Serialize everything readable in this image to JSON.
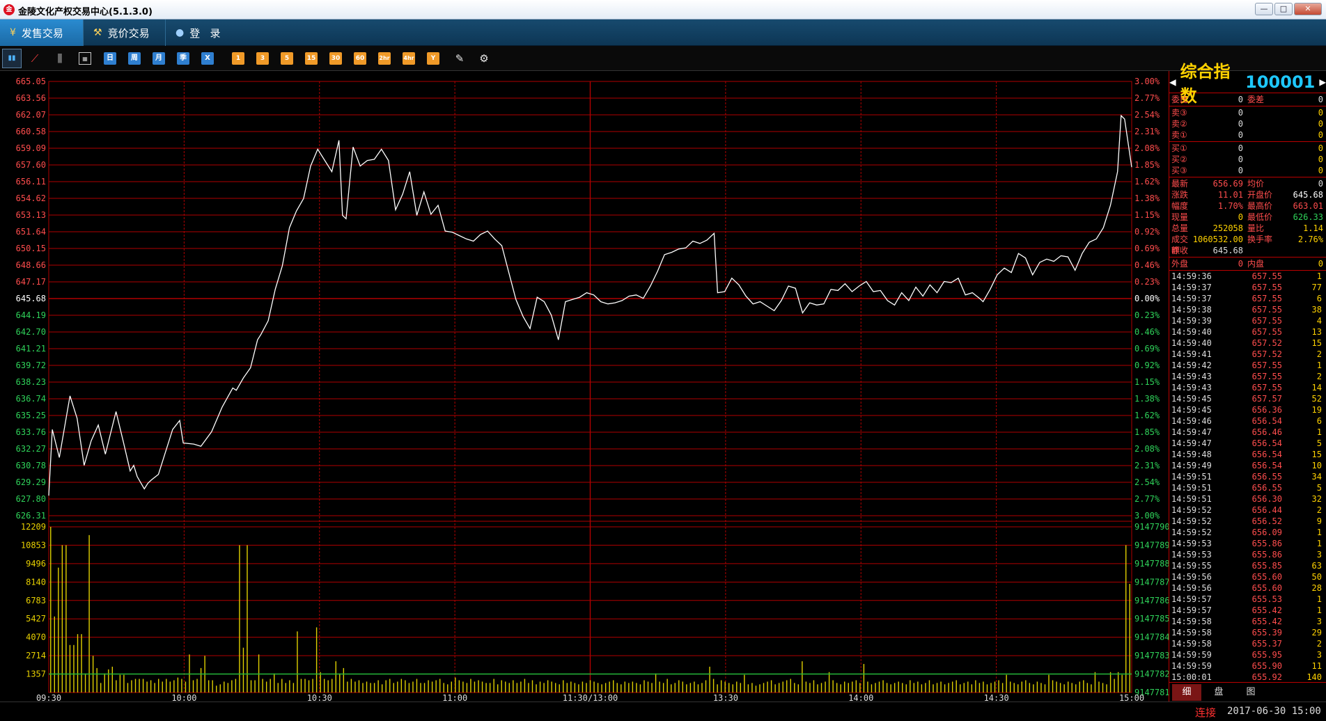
{
  "window": {
    "title": "金陵文化产权交易中心(5.1.3.0)",
    "logo": "logo-icon"
  },
  "tabs": [
    {
      "label": "发售交易",
      "icon": "yen-icon",
      "active": true
    },
    {
      "label": "竞价交易",
      "icon": "gavel-icon",
      "active": false
    },
    {
      "label": "登   录",
      "icon": "user-icon",
      "active": false
    }
  ],
  "toolbar": {
    "text_buttons": [
      "日",
      "周",
      "月",
      "季",
      "X",
      "1",
      "3",
      "5",
      "15",
      "30",
      "60",
      "2hr",
      "4hr",
      "Y"
    ]
  },
  "chart_data": {
    "type": "line",
    "price_axis": {
      "reference": 645.68,
      "left_ticks": [
        "665.05",
        "663.56",
        "662.07",
        "660.58",
        "659.09",
        "657.60",
        "656.11",
        "654.62",
        "653.13",
        "651.64",
        "650.15",
        "648.66",
        "647.17",
        "645.68",
        "644.19",
        "642.70",
        "641.21",
        "639.72",
        "638.23",
        "636.74",
        "635.25",
        "633.76",
        "632.27",
        "630.78",
        "629.29",
        "627.80",
        "626.31"
      ],
      "right_ticks": [
        "3.00%",
        "2.77%",
        "2.54%",
        "2.31%",
        "2.08%",
        "1.85%",
        "1.62%",
        "1.38%",
        "1.15%",
        "0.92%",
        "0.69%",
        "0.46%",
        "0.23%",
        "0.00%",
        "0.23%",
        "0.46%",
        "0.69%",
        "0.92%",
        "1.15%",
        "1.38%",
        "1.62%",
        "1.85%",
        "2.08%",
        "2.31%",
        "2.54%",
        "2.77%",
        "3.00%"
      ],
      "ylim": [
        626.31,
        665.05
      ]
    },
    "volume_axis": {
      "left_ticks": [
        "12209",
        "10853",
        "9496",
        "8140",
        "6783",
        "5427",
        "4070",
        "2714",
        "1357"
      ],
      "right_ticks": [
        "9147790",
        "9147789",
        "9147788",
        "9147787",
        "9147786",
        "9147785",
        "9147784",
        "9147783",
        "9147782",
        "9147781"
      ],
      "ylim": [
        0,
        12209
      ],
      "average": 1357
    },
    "time_labels": [
      "09:30",
      "10:00",
      "10:30",
      "11:00",
      "11:30/13:00",
      "13:30",
      "14:00",
      "14:30",
      "15:00"
    ],
    "price_series": [
      [
        0,
        628.1
      ],
      [
        1,
        634
      ],
      [
        3,
        631.5
      ],
      [
        6,
        637
      ],
      [
        8,
        635
      ],
      [
        10,
        630.8
      ],
      [
        12,
        633
      ],
      [
        14,
        634.4
      ],
      [
        16,
        631.8
      ],
      [
        19,
        635.6
      ],
      [
        21,
        633
      ],
      [
        23,
        630.3
      ],
      [
        24,
        630.8
      ],
      [
        25,
        629.8
      ],
      [
        27,
        628.7
      ],
      [
        28,
        629.2
      ],
      [
        29,
        629.5
      ],
      [
        31,
        630
      ],
      [
        33,
        632
      ],
      [
        35,
        634
      ],
      [
        37,
        634.8
      ],
      [
        38,
        632.8
      ],
      [
        41,
        632.7
      ],
      [
        43,
        632.5
      ],
      [
        46,
        633.8
      ],
      [
        49,
        636
      ],
      [
        52,
        637.7
      ],
      [
        53,
        637.5
      ],
      [
        55,
        638.6
      ],
      [
        57,
        639.5
      ],
      [
        59,
        642
      ],
      [
        60,
        642.5
      ],
      [
        62,
        643.7
      ],
      [
        64,
        646.5
      ],
      [
        66,
        648.6
      ],
      [
        68,
        652
      ],
      [
        70,
        653.5
      ],
      [
        72,
        654.6
      ],
      [
        74,
        657.5
      ],
      [
        76,
        659
      ],
      [
        78,
        658
      ],
      [
        80,
        657
      ],
      [
        82,
        659.8
      ],
      [
        83,
        653.1
      ],
      [
        84,
        652.8
      ],
      [
        86,
        659.2
      ],
      [
        88,
        657.5
      ],
      [
        90,
        658
      ],
      [
        92,
        658.1
      ],
      [
        94,
        659
      ],
      [
        96,
        658
      ],
      [
        98,
        653.6
      ],
      [
        100,
        655
      ],
      [
        102,
        657
      ],
      [
        104,
        653.1
      ],
      [
        106,
        655.2
      ],
      [
        108,
        653.2
      ],
      [
        110,
        654
      ],
      [
        112,
        651.7
      ],
      [
        114,
        651.6
      ],
      [
        116,
        651.3
      ],
      [
        118,
        651
      ],
      [
        120,
        650.8
      ],
      [
        122,
        651.4
      ],
      [
        124,
        651.7
      ],
      [
        126,
        651
      ],
      [
        128,
        650.4
      ],
      [
        130,
        648
      ],
      [
        132,
        645.6
      ],
      [
        134,
        644.1
      ],
      [
        136,
        643
      ],
      [
        138,
        645.8
      ],
      [
        140,
        645.4
      ],
      [
        142,
        644.2
      ],
      [
        144,
        642
      ],
      [
        146,
        645.4
      ],
      [
        148,
        645.6
      ],
      [
        150,
        645.8
      ],
      [
        152,
        646.2
      ],
      [
        154,
        646
      ],
      [
        156,
        645.4
      ],
      [
        158,
        645.2
      ],
      [
        160,
        645.3
      ],
      [
        162,
        645.5
      ],
      [
        164,
        645.9
      ],
      [
        166,
        646
      ],
      [
        168,
        645.7
      ],
      [
        170,
        646.8
      ],
      [
        172,
        648.1
      ],
      [
        174,
        649.6
      ],
      [
        176,
        649.8
      ],
      [
        178,
        650.1
      ],
      [
        180,
        650.2
      ],
      [
        182,
        650.8
      ],
      [
        184,
        650.6
      ],
      [
        186,
        650.9
      ],
      [
        188,
        651.5
      ],
      [
        189,
        646.2
      ],
      [
        191,
        646.3
      ],
      [
        193,
        647.5
      ],
      [
        195,
        646.9
      ],
      [
        197,
        645.9
      ],
      [
        199,
        645.2
      ],
      [
        201,
        645.4
      ],
      [
        203,
        645
      ],
      [
        205,
        644.6
      ],
      [
        207,
        645.5
      ],
      [
        209,
        646.8
      ],
      [
        211,
        646.6
      ],
      [
        213,
        644.4
      ],
      [
        215,
        645.3
      ],
      [
        217,
        645.1
      ],
      [
        219,
        645.2
      ],
      [
        221,
        646.5
      ],
      [
        223,
        646.4
      ],
      [
        225,
        647
      ],
      [
        227,
        646.3
      ],
      [
        229,
        646.8
      ],
      [
        231,
        647.2
      ],
      [
        233,
        646.3
      ],
      [
        235,
        646.4
      ],
      [
        237,
        645.5
      ],
      [
        239,
        645.1
      ],
      [
        241,
        646.2
      ],
      [
        243,
        645.5
      ],
      [
        245,
        646.7
      ],
      [
        247,
        645.9
      ],
      [
        249,
        646.9
      ],
      [
        251,
        646.2
      ],
      [
        253,
        647.2
      ],
      [
        255,
        647.1
      ],
      [
        257,
        647.5
      ],
      [
        259,
        646
      ],
      [
        261,
        646.2
      ],
      [
        263,
        645.7
      ],
      [
        264,
        645.4
      ],
      [
        266,
        646.5
      ],
      [
        268,
        647.8
      ],
      [
        270,
        648.4
      ],
      [
        272,
        648
      ],
      [
        274,
        649.7
      ],
      [
        276,
        649.3
      ],
      [
        278,
        647.8
      ],
      [
        280,
        648.9
      ],
      [
        282,
        649.2
      ],
      [
        284,
        649
      ],
      [
        286,
        649.5
      ],
      [
        288,
        649.4
      ],
      [
        290,
        648.2
      ],
      [
        292,
        649.7
      ],
      [
        294,
        650.7
      ],
      [
        296,
        651
      ],
      [
        298,
        652
      ],
      [
        299,
        653
      ],
      [
        300,
        654
      ],
      [
        302,
        657
      ],
      [
        303,
        662
      ],
      [
        304,
        661.7
      ],
      [
        306,
        657.4
      ]
    ],
    "volume_series": [
      12209,
      5600,
      9200,
      10853,
      10853,
      3500,
      3500,
      4300,
      4300,
      1400,
      11600,
      2700,
      1800,
      700,
      1400,
      1700,
      1900,
      900,
      1300,
      1300,
      700,
      900,
      1000,
      1000,
      1000,
      800,
      900,
      700,
      1000,
      800,
      1000,
      800,
      900,
      1100,
      1000,
      800,
      2800,
      900,
      1000,
      1800,
      2700,
      900,
      900,
      500,
      600,
      800,
      700,
      900,
      1000,
      10853,
      3300,
      10853,
      900,
      900,
      2800,
      1000,
      800,
      1000,
      1400,
      700,
      1000,
      700,
      900,
      700,
      4500,
      1000,
      1000,
      900,
      1000,
      4800,
      1500,
      1000,
      900,
      1000,
      2300,
      1400,
      1800,
      800,
      1000,
      800,
      900,
      700,
      800,
      700,
      700,
      900,
      600,
      900,
      1000,
      700,
      800,
      1000,
      900,
      700,
      800,
      1000,
      700,
      700,
      900,
      800,
      900,
      1000,
      700,
      600,
      800,
      1100,
      900,
      800,
      700,
      1000,
      800,
      900,
      800,
      700,
      700,
      1000,
      600,
      900,
      800,
      700,
      900,
      700,
      800,
      1000,
      700,
      900,
      600,
      800,
      700,
      900,
      800,
      700,
      600,
      900,
      700,
      800,
      700,
      600,
      800,
      700,
      900,
      800,
      700,
      600,
      700,
      800,
      900,
      700,
      600,
      800,
      700,
      800,
      700,
      600,
      900,
      800,
      700,
      1400,
      800,
      700,
      1000,
      600,
      700,
      900,
      800,
      600,
      700,
      800,
      600,
      700,
      900,
      1900,
      1000,
      600,
      900,
      800,
      700,
      600,
      800,
      700,
      1300,
      600,
      700,
      500,
      600,
      700,
      800,
      900,
      600,
      700,
      800,
      900,
      1000,
      700,
      600,
      2300,
      800,
      700,
      900,
      600,
      700,
      800,
      1500,
      900,
      700,
      600,
      800,
      700,
      800,
      900,
      700,
      2100,
      800,
      600,
      700,
      800,
      900,
      700,
      600,
      700,
      800,
      700,
      600,
      900,
      700,
      800,
      600,
      700,
      900,
      600,
      700,
      800,
      600,
      700,
      800,
      900,
      600,
      700,
      800,
      600,
      900,
      700,
      800,
      600,
      700,
      800,
      900,
      700,
      1300,
      800,
      700,
      600,
      800,
      900,
      700,
      600,
      800,
      700,
      600,
      1300,
      900,
      800,
      700,
      600,
      800,
      700,
      600,
      800,
      900,
      700,
      600,
      1500,
      800,
      700,
      600,
      1500,
      1000,
      1500,
      1300,
      10853,
      8000
    ]
  },
  "quote": {
    "name": "综合指数",
    "code": "100001",
    "committee": [
      {
        "l1": "委比",
        "v1": "0",
        "l2": "委差",
        "v2": "0"
      }
    ],
    "sell": [
      {
        "label": "卖③",
        "price": "0",
        "vol": "0"
      },
      {
        "label": "卖②",
        "price": "0",
        "vol": "0"
      },
      {
        "label": "卖①",
        "price": "0",
        "vol": "0"
      }
    ],
    "buy": [
      {
        "label": "买①",
        "price": "0",
        "vol": "0"
      },
      {
        "label": "买②",
        "price": "0",
        "vol": "0"
      },
      {
        "label": "买③",
        "price": "0",
        "vol": "0"
      }
    ],
    "stats": [
      {
        "l1": "最新",
        "v1": "656.69",
        "l2": "均价",
        "v2": "0"
      },
      {
        "l1": "涨跌",
        "v1": "11.01",
        "l2": "开盘价",
        "v2": "645.68"
      },
      {
        "l1": "幅度",
        "v1": "1.70%",
        "l2": "最高价",
        "v2": "663.01"
      },
      {
        "l1": "现量",
        "v1": "0",
        "l2": "最低价",
        "v2": "626.33"
      },
      {
        "l1": "总量",
        "v1": "252058",
        "l2": "量比",
        "v2": "1.14"
      },
      {
        "l1": "成交额",
        "v1": "1060532.00",
        "l2": "换手率",
        "v2": "2.76%"
      },
      {
        "l1": "昨收",
        "v1": "645.68",
        "l2": "",
        "v2": ""
      }
    ],
    "inout": {
      "out_label": "外盘",
      "out_val": "0",
      "in_label": "内盘",
      "in_val": "0"
    }
  },
  "ticks": [
    [
      "14:59:36",
      "657.55",
      "1"
    ],
    [
      "14:59:37",
      "657.55",
      "77"
    ],
    [
      "14:59:37",
      "657.55",
      "6"
    ],
    [
      "14:59:38",
      "657.55",
      "38"
    ],
    [
      "14:59:39",
      "657.55",
      "4"
    ],
    [
      "14:59:40",
      "657.55",
      "13"
    ],
    [
      "14:59:40",
      "657.52",
      "15"
    ],
    [
      "14:59:41",
      "657.52",
      "2"
    ],
    [
      "14:59:42",
      "657.55",
      "1"
    ],
    [
      "14:59:43",
      "657.55",
      "2"
    ],
    [
      "14:59:43",
      "657.55",
      "14"
    ],
    [
      "14:59:45",
      "657.57",
      "52"
    ],
    [
      "14:59:45",
      "656.36",
      "19"
    ],
    [
      "14:59:46",
      "656.54",
      "6"
    ],
    [
      "14:59:47",
      "656.46",
      "1"
    ],
    [
      "14:59:47",
      "656.54",
      "5"
    ],
    [
      "14:59:48",
      "656.54",
      "15"
    ],
    [
      "14:59:49",
      "656.54",
      "10"
    ],
    [
      "14:59:51",
      "656.55",
      "34"
    ],
    [
      "14:59:51",
      "656.55",
      "5"
    ],
    [
      "14:59:51",
      "656.30",
      "32"
    ],
    [
      "14:59:52",
      "656.44",
      "2"
    ],
    [
      "14:59:52",
      "656.52",
      "9"
    ],
    [
      "14:59:52",
      "656.09",
      "1"
    ],
    [
      "14:59:53",
      "655.86",
      "1"
    ],
    [
      "14:59:53",
      "655.86",
      "3"
    ],
    [
      "14:59:55",
      "655.85",
      "63"
    ],
    [
      "14:59:56",
      "655.60",
      "50"
    ],
    [
      "14:59:56",
      "655.60",
      "28"
    ],
    [
      "14:59:57",
      "655.53",
      "1"
    ],
    [
      "14:59:57",
      "655.42",
      "1"
    ],
    [
      "14:59:58",
      "655.42",
      "3"
    ],
    [
      "14:59:58",
      "655.39",
      "29"
    ],
    [
      "14:59:58",
      "655.37",
      "2"
    ],
    [
      "14:59:59",
      "655.95",
      "3"
    ],
    [
      "14:59:59",
      "655.90",
      "11"
    ],
    [
      "15:00:01",
      "655.92",
      "140"
    ]
  ],
  "panel_tabs": [
    "细",
    "盘",
    "图"
  ],
  "status": {
    "connection": "连接",
    "datetime": "2017-06-30 15:00"
  },
  "colors": {
    "grid": "#b00000",
    "price_line": "#ffffff",
    "volume_bar": "#e0d000",
    "avg_line": "#25b83a",
    "up": "#ff4d4d",
    "down": "#2fd35a"
  }
}
